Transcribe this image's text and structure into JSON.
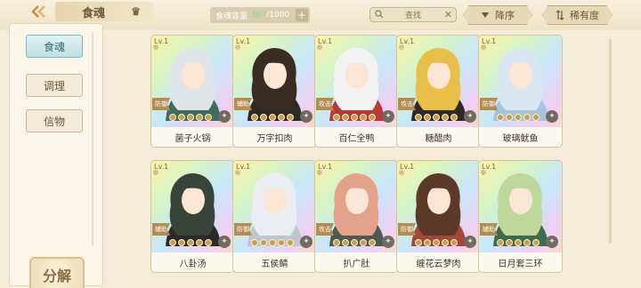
{
  "header": {
    "title": "食魂",
    "capacity_label": "食魂容量",
    "capacity_current": "367",
    "capacity_sep": "/1000",
    "plus": "+",
    "search_text": "查找",
    "clear": "✕",
    "sort_order_label": "降序",
    "sort_rarity_label": "稀有度"
  },
  "sidebar": {
    "tabs": [
      {
        "label": "食魂"
      },
      {
        "label": "调理"
      },
      {
        "label": "信物"
      }
    ],
    "decompose_label": "分解"
  },
  "cards": [
    {
      "lv": "Lv.1",
      "name": "菌子火锅",
      "role": "防御",
      "hair": "#dfe5e8",
      "robe": "#3f6c61"
    },
    {
      "lv": "Lv.1",
      "name": "万字扣肉",
      "role": "辅助",
      "hair": "#3b2c22",
      "robe": "#2e2a26"
    },
    {
      "lv": "Lv.1",
      "name": "百仁全鸭",
      "role": "攻击",
      "hair": "#f3f3f4",
      "robe": "#b63a3a"
    },
    {
      "lv": "Lv.1",
      "name": "糖醋肉",
      "role": "攻击",
      "hair": "#e8bf49",
      "robe": "#2f2a28"
    },
    {
      "lv": "Lv.1",
      "name": "玻璃鱿鱼",
      "role": "防御",
      "hair": "#d9e7f2",
      "robe": "#a8c4dc"
    },
    {
      "lv": "Lv.1",
      "name": "八卦汤",
      "role": "辅助",
      "hair": "#38433a",
      "robe": "#2a2a2a"
    },
    {
      "lv": "Lv.1",
      "name": "五侯鲭",
      "role": "防御",
      "hair": "#eaeef3",
      "robe": "#bfc6cf"
    },
    {
      "lv": "Lv.1",
      "name": "扒广肚",
      "role": "攻击",
      "hair": "#e5a28b",
      "robe": "#4d5a54"
    },
    {
      "lv": "Lv.1",
      "name": "缠花云梦肉",
      "role": "防御",
      "hair": "#5b3a2a",
      "robe": "#a4473b"
    },
    {
      "lv": "Lv.1",
      "name": "日月套三环",
      "role": "辅助",
      "hair": "#bed79a",
      "robe": "#3e6b4b"
    }
  ],
  "colors": {
    "accent": "#2f6c77",
    "gold": "#c79e50",
    "bg": "#f4ecd9"
  }
}
